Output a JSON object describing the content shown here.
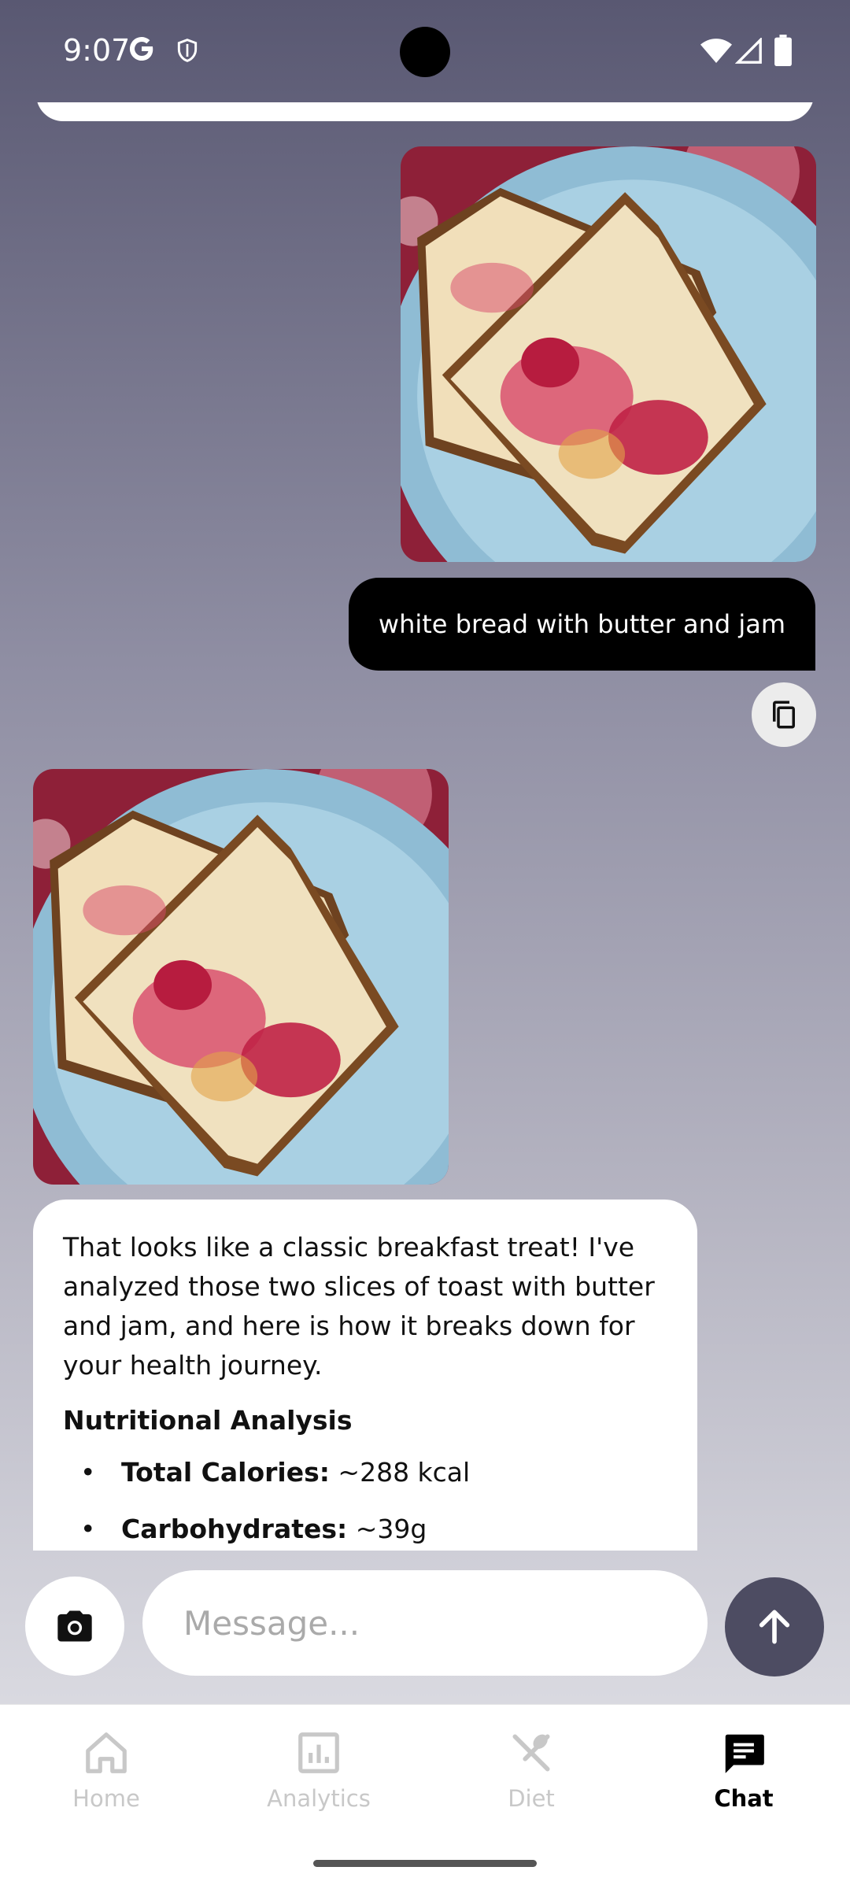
{
  "status_bar": {
    "time": "9:07"
  },
  "chat": {
    "user_message": "white bread with butter and jam",
    "ai_message": {
      "intro": "That looks like a classic breakfast treat! I've analyzed those two slices of toast with butter and jam, and here is how it breaks down for your health journey.",
      "heading": "Nutritional Analysis",
      "items": [
        {
          "label": "Total Calories:",
          "value": "~288 kcal"
        },
        {
          "label": "Carbohydrates:",
          "value": "~39g"
        }
      ]
    }
  },
  "input": {
    "placeholder": "Message..."
  },
  "nav": {
    "items": [
      {
        "label": "Home",
        "icon": "home-icon"
      },
      {
        "label": "Analytics",
        "icon": "analytics-icon"
      },
      {
        "label": "Diet",
        "icon": "diet-icon"
      },
      {
        "label": "Chat",
        "icon": "chat-icon"
      }
    ],
    "active": "Chat"
  },
  "colors": {
    "background_top": "#595872",
    "background_bottom": "#e4e4e8",
    "user_bubble": "#000000",
    "send_button": "#4d4c62",
    "nav_inactive": "#c8c8c8",
    "nav_active": "#000000"
  }
}
